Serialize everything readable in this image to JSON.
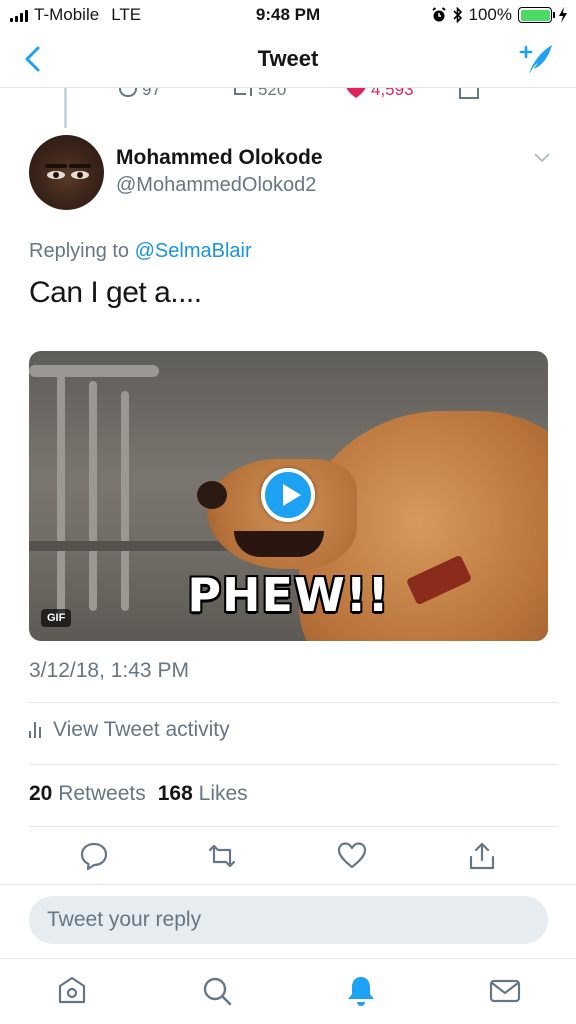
{
  "status_bar": {
    "carrier": "T-Mobile",
    "network": "LTE",
    "time": "9:48 PM",
    "battery": "100%",
    "battery_level": 1.0
  },
  "nav": {
    "title": "Tweet",
    "back_icon": "chevron-left-icon",
    "compose_icon": "compose-tweet-icon",
    "accent_color": "#1da1f2"
  },
  "previous_tweet_actions": {
    "replies": "97",
    "retweets": "520",
    "likes": "4,593"
  },
  "tweet": {
    "display_name": "Mohammed Olokode",
    "handle": "@MohammedOlokod2",
    "replying_prefix": "Replying to",
    "replying_to": "@SelmaBlair",
    "text": "Can I get a....",
    "media": {
      "caption": "PHEW!!",
      "badge": "GIF"
    },
    "timestamp": "3/12/18, 1:43 PM",
    "activity_label": "View Tweet activity",
    "retweets_count": "20",
    "retweets_label": "Retweets",
    "likes_count": "168",
    "likes_label": "Likes"
  },
  "reply": {
    "placeholder": "Tweet your reply"
  },
  "tabbar": {
    "items": [
      "home-icon",
      "search-icon",
      "notifications-icon",
      "messages-icon"
    ],
    "active": "notifications-icon"
  }
}
